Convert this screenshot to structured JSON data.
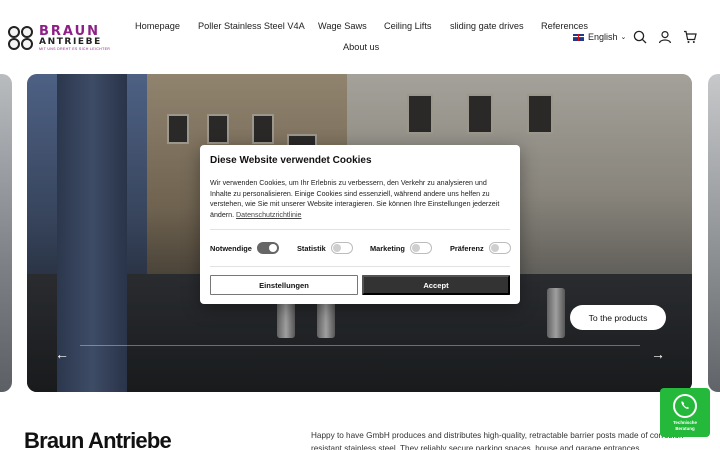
{
  "brand": {
    "logo_text": "BRAUN",
    "logo_sub": "ANTRIEBE",
    "logo_tagline": "MIT UNS DREHT ES SICH LEICHTER",
    "logo_color": "#8e1f86"
  },
  "nav": {
    "items": [
      {
        "label": "Homepage"
      },
      {
        "label": "Poller Stainless Steel V4A"
      },
      {
        "label": "Wage Saws"
      },
      {
        "label": "Ceiling Lifts"
      },
      {
        "label": "sliding gate drives"
      },
      {
        "label": "References"
      },
      {
        "label": "About us"
      }
    ]
  },
  "header_actions": {
    "language": "English",
    "icons": [
      "search-icon",
      "account-icon",
      "cart-icon"
    ]
  },
  "hero": {
    "cta_label": "To the products",
    "prev_icon": "arrow-left-icon",
    "next_icon": "arrow-right-icon"
  },
  "cookie_dialog": {
    "title": "Diese Website verwendet Cookies",
    "body": "Wir verwenden Cookies, um Ihr Erlebnis zu verbessern, den Verkehr zu analysieren und Inhalte zu personalisieren. Einige Cookies sind essenziell, während andere uns helfen zu verstehen, wie Sie mit unserer Website interagieren. Sie können Ihre Einstellungen jederzeit ändern.",
    "privacy_link": "Datenschutzrichtlinie",
    "toggles": [
      {
        "label": "Notwendige",
        "on": true
      },
      {
        "label": "Statistik",
        "on": false
      },
      {
        "label": "Marketing",
        "on": false
      },
      {
        "label": "Präferenz",
        "on": false
      }
    ],
    "settings_label": "Einstellungen",
    "accept_label": "Accept"
  },
  "content": {
    "heading": "Braun Antriebe",
    "intro": "Happy to have GmbH produces and distributes high-quality, retractable barrier posts made of corrosion-resistant stainless steel. They reliably secure parking spaces, house and garage entrances."
  },
  "whatsapp": {
    "label_line1": "Technische",
    "label_line2": "Beratung",
    "color": "#25b93b"
  }
}
